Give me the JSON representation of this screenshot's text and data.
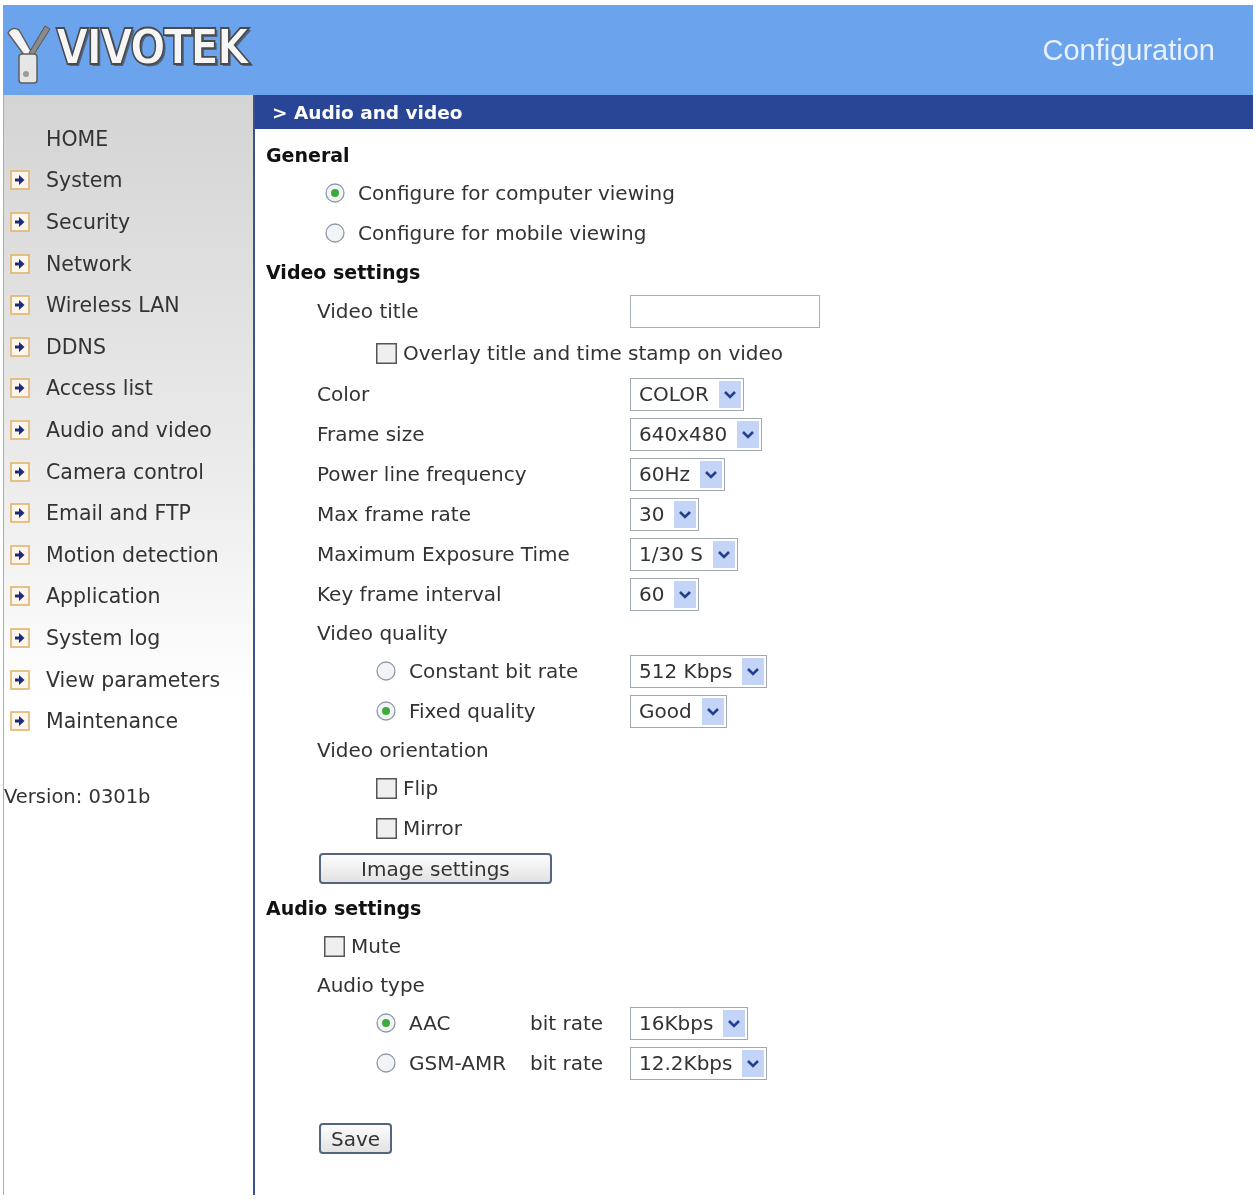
{
  "header": {
    "logo": "VIVOTEK",
    "title": "Configuration"
  },
  "sidebar": {
    "items": [
      {
        "label": "HOME",
        "kind": "plain"
      },
      {
        "label": "System",
        "kind": "section"
      },
      {
        "label": "Security",
        "kind": "section"
      },
      {
        "label": "Network",
        "kind": "section"
      },
      {
        "label": "Wireless LAN",
        "kind": "section"
      },
      {
        "label": "DDNS",
        "kind": "section"
      },
      {
        "label": "Access list",
        "kind": "section"
      },
      {
        "label": "Audio and video",
        "kind": "section"
      },
      {
        "label": "Camera control",
        "kind": "section"
      },
      {
        "label": "Email and FTP",
        "kind": "section"
      },
      {
        "label": "Motion detection",
        "kind": "section"
      },
      {
        "label": "Application",
        "kind": "section"
      },
      {
        "label": "System log",
        "kind": "section"
      },
      {
        "label": "View parameters",
        "kind": "section"
      },
      {
        "label": "Maintenance",
        "kind": "section"
      }
    ],
    "version": "Version: 0301b"
  },
  "page_title": "> Audio and video",
  "general": {
    "heading": "General",
    "options": [
      {
        "label": "Configure for computer viewing",
        "selected": true
      },
      {
        "label": "Configure for mobile viewing",
        "selected": false
      }
    ]
  },
  "video_settings": {
    "heading": "Video settings",
    "rows": [
      {
        "kind": "text",
        "label": "Video title",
        "children": [
          {
            "kind": "checkbox",
            "label": "Overlay title and time stamp on video",
            "checked": false
          }
        ]
      },
      {
        "kind": "select",
        "label": "Color",
        "value": "COLOR"
      },
      {
        "kind": "select",
        "label": "Frame size",
        "value": "640x480"
      },
      {
        "kind": "select",
        "label": "Power line frequency",
        "value": "60Hz"
      },
      {
        "kind": "select",
        "label": "Max frame rate",
        "value": "30"
      },
      {
        "kind": "select",
        "label": "Maximum Exposure Time",
        "value": "1/30 S"
      },
      {
        "kind": "select",
        "label": "Key frame interval",
        "value": "60"
      },
      {
        "kind": "caption",
        "label": "Video quality",
        "children": [
          {
            "kind": "radio",
            "label": "Constant bit rate",
            "selected": false,
            "value": "512 Kbps"
          },
          {
            "kind": "radio",
            "label": "Fixed quality",
            "selected": true,
            "value": "Good"
          }
        ]
      },
      {
        "kind": "caption",
        "label": "Video orientation",
        "children": [
          {
            "kind": "checkbox",
            "label": "Flip",
            "checked": false
          },
          {
            "kind": "checkbox",
            "label": "Mirror",
            "checked": false
          }
        ]
      },
      {
        "kind": "button",
        "label": "Image settings"
      }
    ]
  },
  "audio_settings": {
    "heading": "Audio settings",
    "rows": [
      {
        "kind": "checkbox",
        "label": "Mute",
        "checked": false
      },
      {
        "kind": "caption",
        "label": "Audio type",
        "children": [
          {
            "kind": "radio",
            "label": "AAC",
            "selected": true,
            "rate_label": "bit rate",
            "value": "16Kbps"
          },
          {
            "kind": "radio",
            "label": "GSM-AMR",
            "selected": false,
            "rate_label": "bit rate",
            "value": "12.2Kbps"
          }
        ]
      }
    ]
  },
  "save_button": "Save"
}
